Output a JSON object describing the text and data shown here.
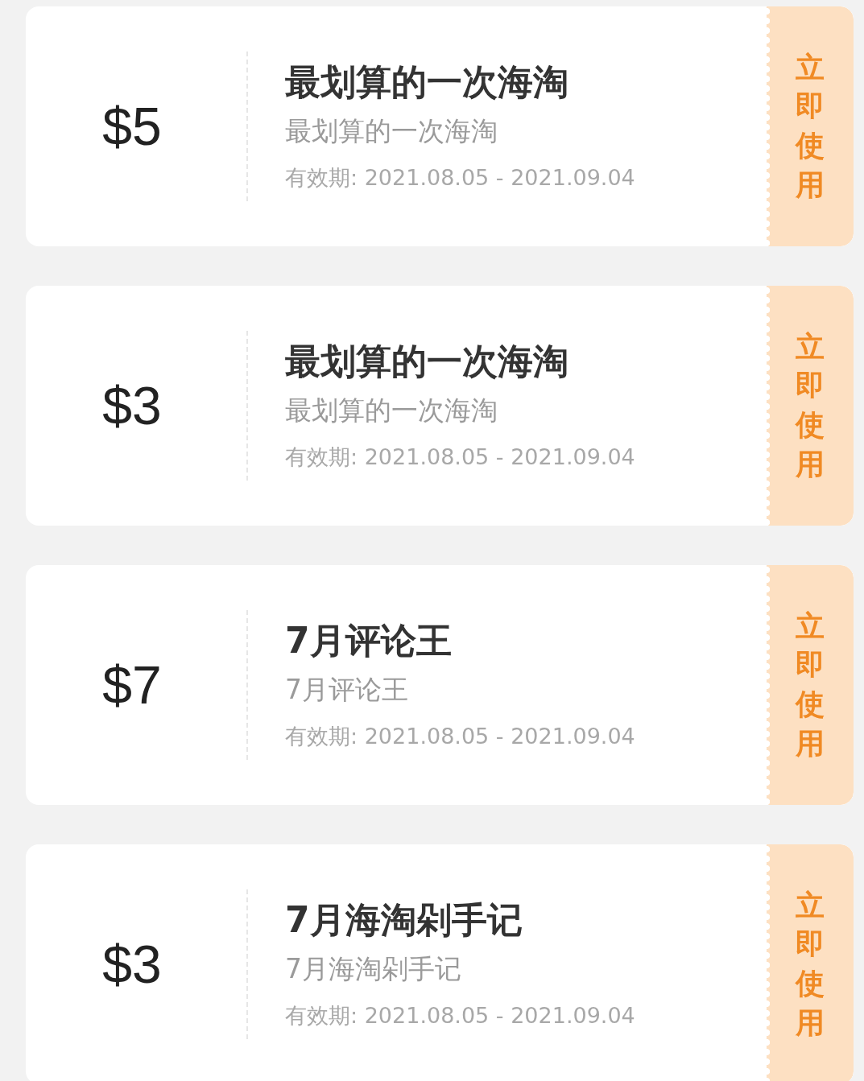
{
  "coupons": [
    {
      "amount": "$5",
      "title": "最划算的一次海淘",
      "subtitle": "最划算的一次海淘",
      "validity": "有效期: 2021.08.05 - 2021.09.04",
      "action": "立即使用"
    },
    {
      "amount": "$3",
      "title": "最划算的一次海淘",
      "subtitle": "最划算的一次海淘",
      "validity": "有效期: 2021.08.05 - 2021.09.04",
      "action": "立即使用"
    },
    {
      "amount": "$7",
      "title": "7月评论王",
      "subtitle": "7月评论王",
      "validity": "有效期: 2021.08.05 - 2021.09.04",
      "action": "立即使用"
    },
    {
      "amount": "$3",
      "title": "7月海淘剁手记",
      "subtitle": "7月海淘剁手记",
      "validity": "有效期: 2021.08.05 - 2021.09.04",
      "action": "立即使用"
    }
  ]
}
